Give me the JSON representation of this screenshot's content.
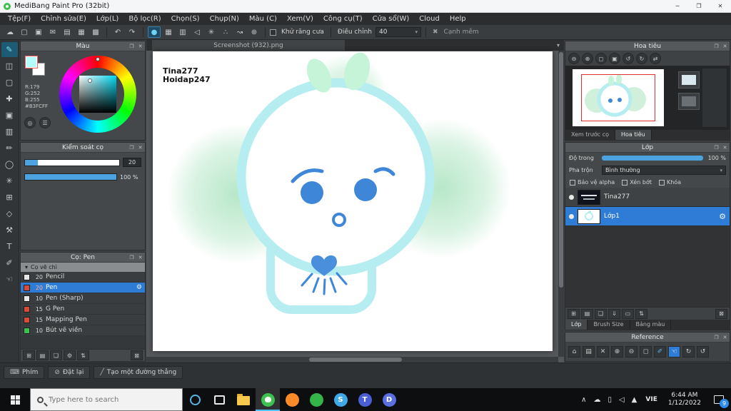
{
  "colors": {
    "accent_blue": "#2f7cd6",
    "slider_blue": "#4ca3e0",
    "primary_swatch": "#B3FCFF",
    "outline_cyan": "#b5edf1",
    "eye_blue": "#3e86d8",
    "leaf_green": "#c5f4d8",
    "badge_blue": "#2d8ceb"
  },
  "titlebar": {
    "title": "MediBang Paint Pro (32bit)",
    "minimize_glyph": "─",
    "maximize_glyph": "❐",
    "close_glyph": "✕"
  },
  "menubar": {
    "items": [
      "Tệp(F)",
      "Chỉnh sửa(E)",
      "Lớp(L)",
      "Bộ lọc(R)",
      "Chọn(S)",
      "Chụp(N)",
      "Màu (C)",
      "Xem(V)",
      "Công cụ(T)",
      "Cửa sổ(W)",
      "Cloud",
      "Help"
    ]
  },
  "toolbar": {
    "file_group": [
      {
        "name": "cloud",
        "glyph": "☁"
      },
      {
        "name": "new-canvas",
        "glyph": "▢"
      },
      {
        "name": "save",
        "glyph": "▣"
      },
      {
        "name": "comment",
        "glyph": "✉"
      },
      {
        "name": "panel-layout",
        "glyph": "▤"
      },
      {
        "name": "grid-view",
        "glyph": "▦"
      },
      {
        "name": "material",
        "glyph": "▩"
      }
    ],
    "undo_glyph": "↶",
    "redo_glyph": "↷",
    "brush_group": [
      {
        "name": "brush-tip",
        "glyph": "●"
      },
      {
        "name": "brush-size-grid",
        "glyph": "▦"
      },
      {
        "name": "texture",
        "glyph": "▥"
      },
      {
        "name": "vector",
        "glyph": "◁"
      },
      {
        "name": "symmetry",
        "glyph": "✳"
      },
      {
        "name": "scatter",
        "glyph": "∴"
      },
      {
        "name": "correction",
        "glyph": "↝"
      },
      {
        "name": "stabilizer",
        "glyph": "⊕"
      }
    ],
    "antialias_label": "Khử răng cưa",
    "adjust_label": "Điều chỉnh",
    "adjust_value": "40",
    "dropdown_glyph": "▾",
    "softedge_x_glyph": "✖",
    "softedge_label": "Cạnh mềm"
  },
  "tools": [
    {
      "name": "brush-tool",
      "glyph": "✎"
    },
    {
      "name": "eraser-tool",
      "glyph": "◫"
    },
    {
      "name": "select-tool",
      "glyph": "▢"
    },
    {
      "name": "move-tool",
      "glyph": "✚"
    },
    {
      "name": "fill-tool",
      "glyph": "▣"
    },
    {
      "name": "gradient-tool",
      "glyph": "▥"
    },
    {
      "name": "select-pen-tool",
      "glyph": "✏"
    },
    {
      "name": "lasso-tool",
      "glyph": "◯"
    },
    {
      "name": "wand-tool",
      "glyph": "✳"
    },
    {
      "name": "divide-tool",
      "glyph": "⊞"
    },
    {
      "name": "shape-tool",
      "glyph": "◇"
    },
    {
      "name": "operation-tool",
      "glyph": "⚒"
    },
    {
      "name": "text-tool",
      "glyph": "T"
    },
    {
      "name": "eyedropper-tool",
      "glyph": "✐"
    },
    {
      "name": "hand-tool",
      "glyph": "☜"
    }
  ],
  "panel_chrome": {
    "float_glyph": "❐",
    "close_glyph": "✕"
  },
  "color_panel": {
    "title": "Màu",
    "r": "R:179",
    "g": "G:252",
    "b": "B:255",
    "hex": "#B3FCFF",
    "view_tools": [
      {
        "name": "wheel-view",
        "glyph": "◎"
      },
      {
        "name": "slider-view",
        "glyph": "☰"
      }
    ]
  },
  "brush_control": {
    "title": "Kiểm soát cọ",
    "size_value": "20",
    "opacity_value": "100 %"
  },
  "brush_panel": {
    "title": "Cọ: Pen",
    "group_arrow": "▾",
    "group_label": "Cọ vẽ chì",
    "gear_glyph": "⚙",
    "brushes": [
      {
        "size": "20",
        "name": "Pencil",
        "chip": "#e8e8e8"
      },
      {
        "size": "20",
        "name": "Pen",
        "chip": "#d84a3a"
      },
      {
        "size": "10",
        "name": "Pen (Sharp)",
        "chip": "#e8e8e8"
      },
      {
        "size": "15",
        "name": "G Pen",
        "chip": "#d84a3a"
      },
      {
        "size": "15",
        "name": "Mapping Pen",
        "chip": "#d84a3a"
      },
      {
        "size": "10",
        "name": "Bút vẽ viền",
        "chip": "#3fc04e"
      }
    ],
    "footer_icons": [
      {
        "name": "add-brush",
        "glyph": "⊞"
      },
      {
        "name": "add-brush-folder",
        "glyph": "▤"
      },
      {
        "name": "duplicate-brush",
        "glyph": "❏"
      },
      {
        "name": "brush-settings",
        "glyph": "⚙"
      },
      {
        "name": "brush-reorder",
        "glyph": "⇅"
      },
      {
        "name": "delete-brush",
        "glyph": "⊠"
      }
    ]
  },
  "bottom_bar": {
    "key_glyph": "⌨",
    "key_label": "Phím",
    "reset_glyph": "⊘",
    "reset_label": "Đặt lại",
    "line_glyph": "╱",
    "line_label": "Tạo một đường thẳng"
  },
  "canvas": {
    "tab": "Screenshot (932).png",
    "tab_menu_glyph": "▾",
    "watermark_line1": "Tina277",
    "watermark_line2": "Hoidap247"
  },
  "navigator": {
    "title": "Hoa tiêu",
    "tools": [
      {
        "name": "zoom-out",
        "glyph": "⊖"
      },
      {
        "name": "zoom-in",
        "glyph": "⊕"
      },
      {
        "name": "fit-window",
        "glyph": "◻"
      },
      {
        "name": "actual-size",
        "glyph": "▣"
      },
      {
        "name": "rotate-left",
        "glyph": "↺"
      },
      {
        "name": "rotate-right",
        "glyph": "↻"
      },
      {
        "name": "flip",
        "glyph": "⇄"
      }
    ],
    "tabs": [
      "Xem trước cọ",
      "Hoa tiêu"
    ]
  },
  "layers_panel": {
    "title": "Lớp",
    "opacity_label": "Độ trong",
    "opacity_value": "100 %",
    "blend_label": "Pha trộn",
    "blend_value": "Bình thường",
    "dropdown_glyph": "▾",
    "checkbox_alpha": "Bảo vệ alpha",
    "checkbox_clip": "Xén bớt",
    "checkbox_lock": "Khóa",
    "gear_glyph": "⚙",
    "layers": [
      {
        "name": "Tina277"
      },
      {
        "name": "Lớp1"
      }
    ],
    "footer_icons": [
      {
        "name": "add-layer",
        "glyph": "⊞"
      },
      {
        "name": "add-layer-folder",
        "glyph": "▤"
      },
      {
        "name": "duplicate-layer",
        "glyph": "❏"
      },
      {
        "name": "merge-layer",
        "glyph": "⇓"
      },
      {
        "name": "clear-layer",
        "glyph": "▭"
      },
      {
        "name": "layer-reorder",
        "glyph": "⇅"
      },
      {
        "name": "delete-layer",
        "glyph": "⊠"
      }
    ],
    "tabs": [
      "Lớp",
      "Brush Size",
      "Bảng màu"
    ]
  },
  "reference_panel": {
    "title": "Reference",
    "tools": [
      {
        "name": "ref-home",
        "glyph": "⌂"
      },
      {
        "name": "ref-folder",
        "glyph": "▤"
      },
      {
        "name": "ref-close",
        "glyph": "✕"
      },
      {
        "name": "ref-zoom-in",
        "glyph": "⊕"
      },
      {
        "name": "ref-zoom-out",
        "glyph": "⊖"
      },
      {
        "name": "ref-fit",
        "glyph": "◻"
      },
      {
        "name": "ref-eyedropper",
        "glyph": "✐"
      },
      {
        "name": "ref-hand",
        "glyph": "☜"
      },
      {
        "name": "ref-rotate",
        "glyph": "↻"
      },
      {
        "name": "ref-reset",
        "glyph": "↺"
      }
    ]
  },
  "taskbar": {
    "search_placeholder": "Type here to search",
    "lang": "VIE",
    "time": "6:44 AM",
    "date": "1/12/2022",
    "badge": "9",
    "apps": [
      {
        "name": "file-explorer",
        "color": "#f6c84c",
        "letter": ""
      },
      {
        "name": "medibang",
        "color": "#3ec14f",
        "letter": ""
      },
      {
        "name": "firefox",
        "color": "#ff8a2a",
        "letter": ""
      },
      {
        "name": "coccoc",
        "color": "#35b44a",
        "letter": ""
      },
      {
        "name": "skype",
        "color": "#3fa9e8",
        "letter": "S"
      },
      {
        "name": "teams",
        "color": "#4a5fd4",
        "letter": "T"
      },
      {
        "name": "discord",
        "color": "#5c6fe0",
        "letter": "D"
      }
    ],
    "tray": [
      {
        "name": "tray-expand",
        "glyph": "∧"
      },
      {
        "name": "onedrive",
        "glyph": "☁"
      },
      {
        "name": "battery",
        "glyph": "▯"
      },
      {
        "name": "volume",
        "glyph": "◁"
      },
      {
        "name": "network",
        "glyph": "▲"
      }
    ]
  }
}
